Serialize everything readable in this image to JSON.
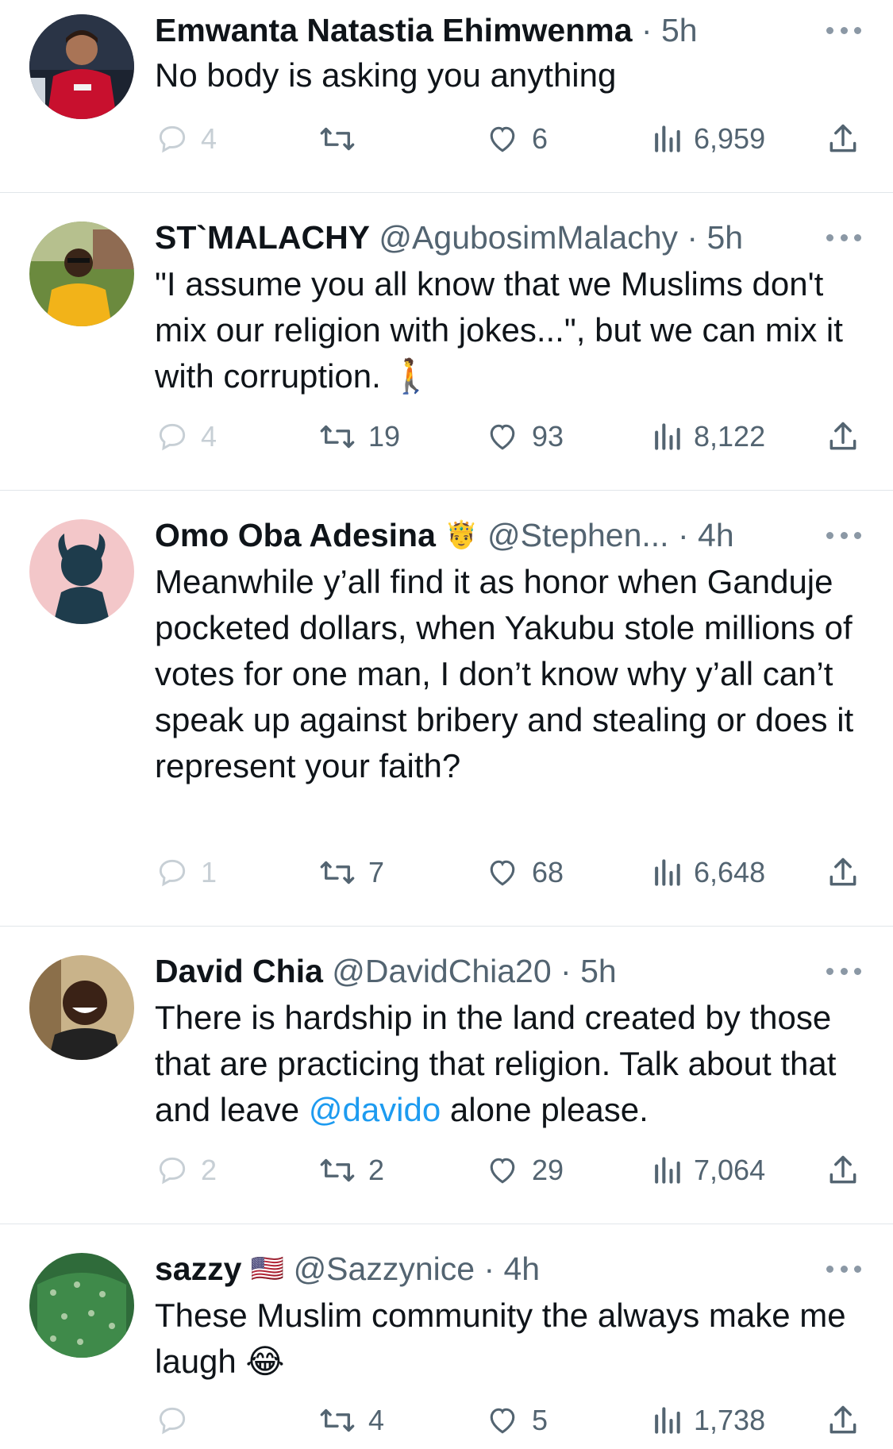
{
  "tweets": [
    {
      "name": "Emwanta Natastia Ehimwenma",
      "flag": "",
      "handle": "",
      "time_sep": " · 5h",
      "text": "No body is asking you anything",
      "reply_count": "4",
      "retweet_count": "",
      "like_count": "6",
      "view_count": "6,959"
    },
    {
      "name": "ST`MALACHY",
      "flag": "",
      "handle": " @AgubosimMalachy",
      "time_sep": " · 5h",
      "text": "\"I assume you all know that we Muslims don't mix our religion with jokes...\",  but we can mix it with corruption. 🚶",
      "reply_count": "4",
      "retweet_count": "19",
      "like_count": "93",
      "view_count": "8,122"
    },
    {
      "name": "Omo Oba Adesina",
      "flag": "🤴",
      "handle": " @Stephen...",
      "time_sep": " · 4h",
      "text": "Meanwhile y’all find it as honor when Ganduje pocketed dollars, when Yakubu stole millions of votes for one man, I don’t know why y’all can’t speak up against bribery and stealing or does it represent your faith?",
      "reply_count": "1",
      "retweet_count": "7",
      "like_count": "68",
      "view_count": "6,648"
    },
    {
      "name": "David Chia",
      "flag": "",
      "handle": " @DavidChia20",
      "time_sep": " · 5h",
      "text_before": "There is hardship in the land created by those that are practicing that religion. Talk about that and leave ",
      "mention": "@davido",
      "text_after": " alone please.",
      "reply_count": "2",
      "retweet_count": "2",
      "like_count": "29",
      "view_count": "7,064"
    },
    {
      "name": "sazzy",
      "flag": "🇺🇸",
      "handle": " @Sazzynice",
      "time_sep": " · 4h",
      "text": "These Muslim community the always make me laugh 😂",
      "reply_count": "",
      "retweet_count": "4",
      "like_count": "5",
      "view_count": "1,738"
    }
  ],
  "icons": {
    "reply": "comment-bubble-icon",
    "retweet": "retweet-arrows-icon",
    "like": "heart-icon",
    "views": "bar-chart-icon",
    "share": "share-upload-icon",
    "more": "more-dots-icon"
  },
  "colors": {
    "text": "#0f1419",
    "muted": "#536471",
    "link": "#1d9bf0",
    "divider": "#e1e6ea"
  }
}
